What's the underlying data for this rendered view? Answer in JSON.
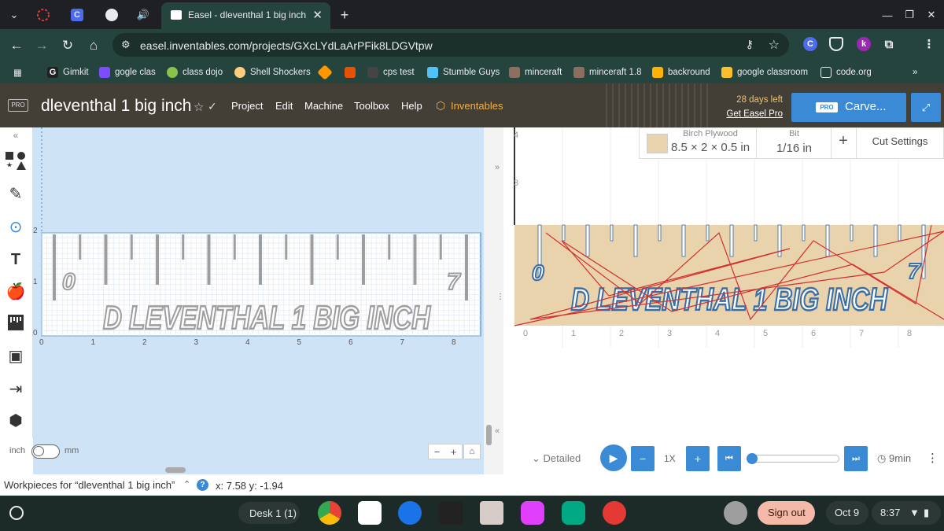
{
  "browser": {
    "tab_title": "Easel - dleventhal 1 big inch",
    "url": "easel.inventables.com/projects/GXcLYdLaArPFik8LDGVtpw",
    "bookmarks": [
      "Gimkit",
      "gogle clas",
      "class dojo",
      "Shell Shockers",
      "cps test",
      "Stumble Guys",
      "minceraft",
      "minceraft 1.8",
      "backround",
      "google classroom",
      "code.org"
    ],
    "extensions": [
      "C",
      "k"
    ]
  },
  "header": {
    "pro_badge": "PRO",
    "project_title": "dleventhal 1 big inch",
    "menu": [
      "Project",
      "Edit",
      "Machine",
      "Toolbox",
      "Help"
    ],
    "brand": "Inventables",
    "trial_text": "28 days left",
    "get_pro": "Get Easel Pro",
    "carve_pro": "PRO",
    "carve_label": "Carve..."
  },
  "design": {
    "y_ticks": [
      "2",
      "1",
      "0"
    ],
    "x_ticks": [
      "0",
      "1",
      "2",
      "3",
      "4",
      "5",
      "6",
      "7",
      "8"
    ],
    "ruler_text": "D LEVENTHAL 1 BIG INCH",
    "start_mark": "0",
    "end_mark": "7",
    "unit_inch": "inch",
    "unit_mm": "mm"
  },
  "preview": {
    "material_name": "Birch Plywood",
    "material_size": "8.5 × 2 × 0.5 in",
    "bit_label": "Bit",
    "bit_value": "1/16 in",
    "add": "+",
    "cut_settings": "Cut Settings",
    "y_ticks": [
      "4",
      "3"
    ],
    "x_ticks": [
      "0",
      "1",
      "2",
      "3",
      "4",
      "5",
      "6",
      "7",
      "8"
    ],
    "detail": "Detailed",
    "speed": "1X",
    "time": "9min",
    "progress": 0.0
  },
  "footer": {
    "workpieces": "Workpieces for “dleventhal 1 big inch”",
    "coords": "x: 7.58 y: -1.94"
  },
  "shelf": {
    "desk": "Desk 1 (1)",
    "sign_out": "Sign out",
    "date": "Oct 9",
    "time": "8:37"
  },
  "colors": {
    "header_bg": "#433e36",
    "accent": "#3a8ad6",
    "canvas_bg": "#cfe3f7",
    "wood": "#e8d3ad",
    "brand": "#f4b23f"
  }
}
